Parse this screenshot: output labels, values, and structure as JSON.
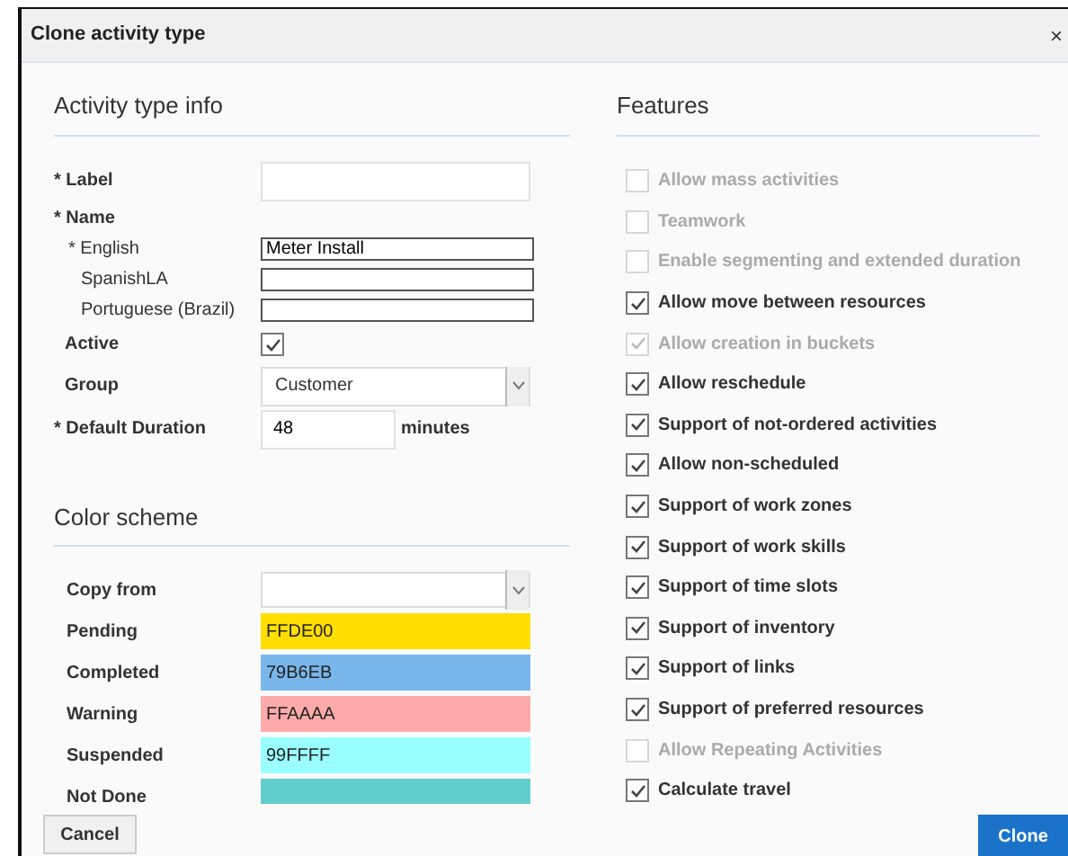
{
  "dialog": {
    "title": "Clone activity type",
    "close": "×"
  },
  "activity_info": {
    "heading": "Activity type info",
    "label": {
      "text": "* Label"
    },
    "name": {
      "text": "* Name"
    },
    "languages": [
      {
        "text": "* English",
        "value": "Meter Install"
      },
      {
        "text": "SpanishLA"
      },
      {
        "text": "Portuguese (Brazil)"
      }
    ],
    "active": {
      "text": "Active",
      "checked": true
    },
    "group": {
      "text": "Group",
      "value": "Customer"
    },
    "duration": {
      "text": "* Default Duration",
      "value": "48",
      "unit": "minutes"
    }
  },
  "color_scheme": {
    "heading": "Color scheme",
    "copy_from": {
      "text": "Copy from"
    },
    "rows": [
      {
        "text": "Pending",
        "value": "FFDE00",
        "color": "#ffde00"
      },
      {
        "text": "Completed",
        "value": "79B6EB",
        "color": "#79b6eb"
      },
      {
        "text": "Warning",
        "value": "FFAAAA",
        "color": "#ffaaaa"
      },
      {
        "text": "Suspended",
        "value": "99FFFF",
        "color": "#99ffff"
      },
      {
        "text": "Not Done",
        "color": "#60cecc"
      }
    ]
  },
  "features": {
    "heading": "Features",
    "items": [
      {
        "text": "Allow mass activities",
        "checked": false,
        "disabled": true
      },
      {
        "text": "Teamwork",
        "checked": false,
        "disabled": true
      },
      {
        "text": "Enable segmenting and extended duration",
        "checked": false,
        "disabled": true
      },
      {
        "text": "Allow move between resources",
        "checked": true,
        "disabled": false
      },
      {
        "text": "Allow creation in buckets",
        "checked": true,
        "disabled": true
      },
      {
        "text": "Allow reschedule",
        "checked": true,
        "disabled": false
      },
      {
        "text": "Support of not-ordered activities",
        "checked": true,
        "disabled": false
      },
      {
        "text": "Allow non-scheduled",
        "checked": true,
        "disabled": false
      },
      {
        "text": "Support of work zones",
        "checked": true,
        "disabled": false
      },
      {
        "text": "Support of work skills",
        "checked": true,
        "disabled": false
      },
      {
        "text": "Support of time slots",
        "checked": true,
        "disabled": false
      },
      {
        "text": "Support of inventory",
        "checked": true,
        "disabled": false
      },
      {
        "text": "Support of links",
        "checked": true,
        "disabled": false
      },
      {
        "text": "Support of preferred resources",
        "checked": true,
        "disabled": false
      },
      {
        "text": "Allow Repeating Activities",
        "checked": false,
        "disabled": true
      },
      {
        "text": "Calculate travel",
        "checked": true,
        "disabled": false
      }
    ]
  },
  "buttons": {
    "cancel": "Cancel",
    "clone": "Clone"
  }
}
